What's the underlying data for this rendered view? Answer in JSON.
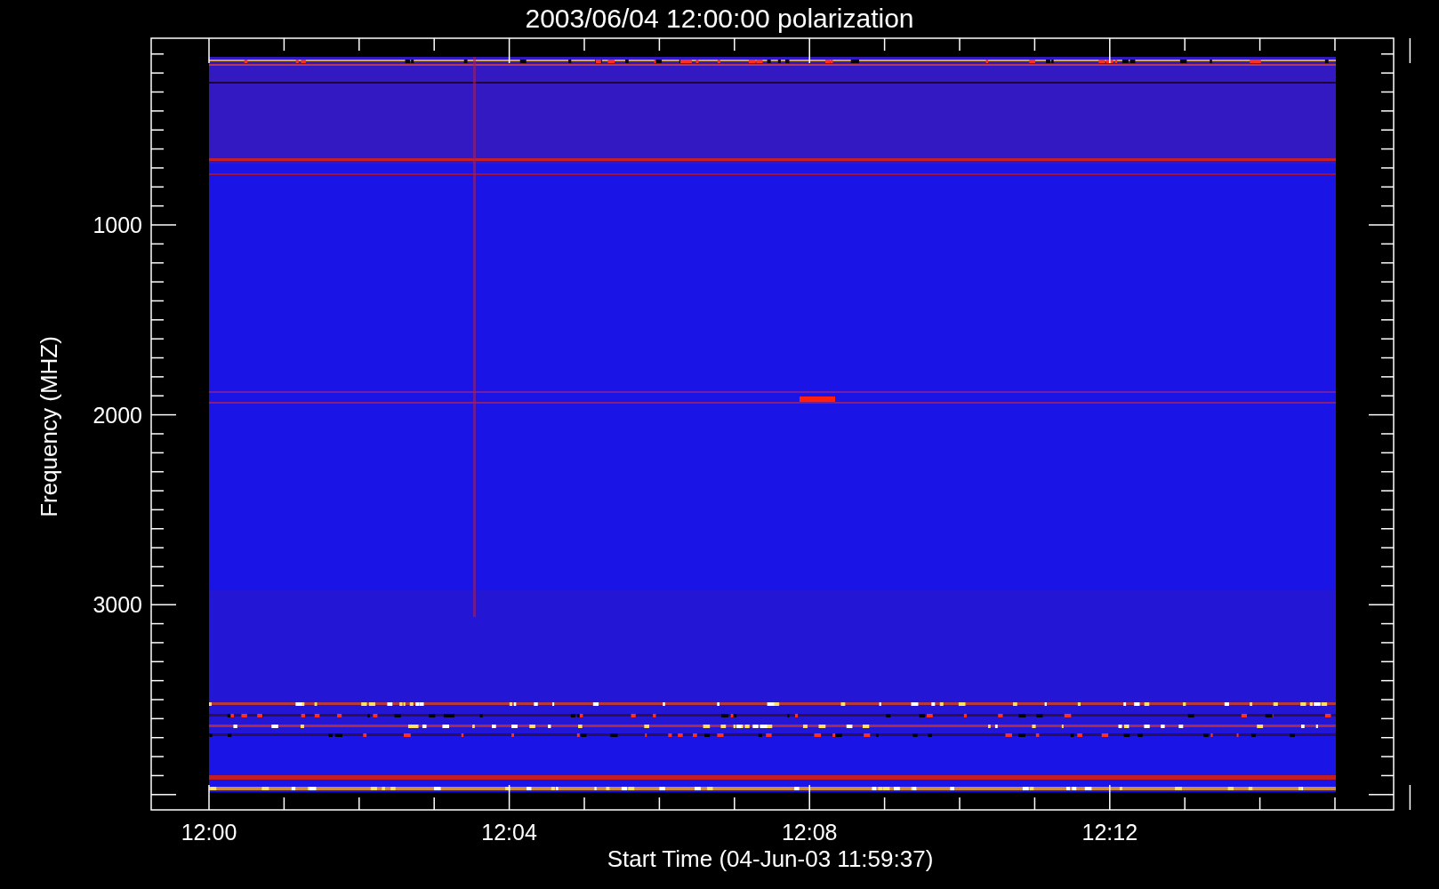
{
  "title": "2003/06/04 12:00:00 polarization",
  "y_axis": {
    "label": "Frequency (MHZ)",
    "ticks": [
      "1000",
      "2000",
      "3000"
    ]
  },
  "x_axis": {
    "label": "Start Time (04-Jun-03 11:59:37)",
    "ticks": [
      "12:00",
      "12:04",
      "12:08",
      "12:12"
    ]
  }
}
